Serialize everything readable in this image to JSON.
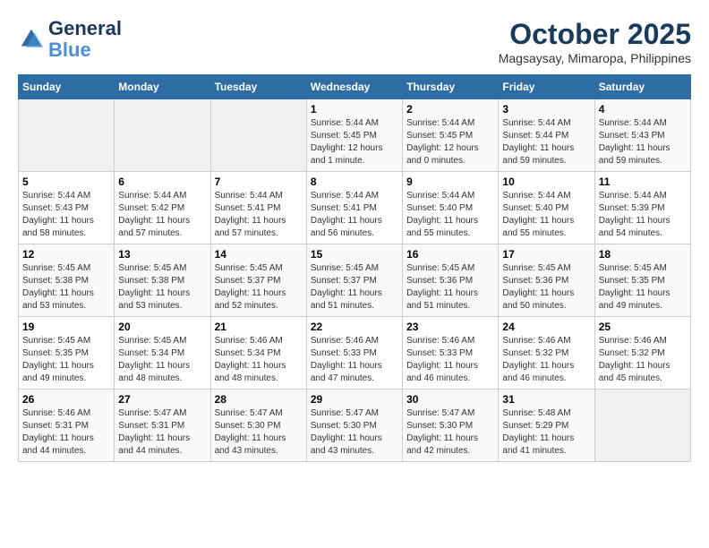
{
  "header": {
    "logo_line1": "General",
    "logo_line2": "Blue",
    "month": "October 2025",
    "location": "Magsaysay, Mimaropa, Philippines"
  },
  "days_of_week": [
    "Sunday",
    "Monday",
    "Tuesday",
    "Wednesday",
    "Thursday",
    "Friday",
    "Saturday"
  ],
  "weeks": [
    [
      {
        "day": "",
        "info": ""
      },
      {
        "day": "",
        "info": ""
      },
      {
        "day": "",
        "info": ""
      },
      {
        "day": "1",
        "info": "Sunrise: 5:44 AM\nSunset: 5:45 PM\nDaylight: 12 hours\nand 1 minute."
      },
      {
        "day": "2",
        "info": "Sunrise: 5:44 AM\nSunset: 5:45 PM\nDaylight: 12 hours\nand 0 minutes."
      },
      {
        "day": "3",
        "info": "Sunrise: 5:44 AM\nSunset: 5:44 PM\nDaylight: 11 hours\nand 59 minutes."
      },
      {
        "day": "4",
        "info": "Sunrise: 5:44 AM\nSunset: 5:43 PM\nDaylight: 11 hours\nand 59 minutes."
      }
    ],
    [
      {
        "day": "5",
        "info": "Sunrise: 5:44 AM\nSunset: 5:43 PM\nDaylight: 11 hours\nand 58 minutes."
      },
      {
        "day": "6",
        "info": "Sunrise: 5:44 AM\nSunset: 5:42 PM\nDaylight: 11 hours\nand 57 minutes."
      },
      {
        "day": "7",
        "info": "Sunrise: 5:44 AM\nSunset: 5:41 PM\nDaylight: 11 hours\nand 57 minutes."
      },
      {
        "day": "8",
        "info": "Sunrise: 5:44 AM\nSunset: 5:41 PM\nDaylight: 11 hours\nand 56 minutes."
      },
      {
        "day": "9",
        "info": "Sunrise: 5:44 AM\nSunset: 5:40 PM\nDaylight: 11 hours\nand 55 minutes."
      },
      {
        "day": "10",
        "info": "Sunrise: 5:44 AM\nSunset: 5:40 PM\nDaylight: 11 hours\nand 55 minutes."
      },
      {
        "day": "11",
        "info": "Sunrise: 5:44 AM\nSunset: 5:39 PM\nDaylight: 11 hours\nand 54 minutes."
      }
    ],
    [
      {
        "day": "12",
        "info": "Sunrise: 5:45 AM\nSunset: 5:38 PM\nDaylight: 11 hours\nand 53 minutes."
      },
      {
        "day": "13",
        "info": "Sunrise: 5:45 AM\nSunset: 5:38 PM\nDaylight: 11 hours\nand 53 minutes."
      },
      {
        "day": "14",
        "info": "Sunrise: 5:45 AM\nSunset: 5:37 PM\nDaylight: 11 hours\nand 52 minutes."
      },
      {
        "day": "15",
        "info": "Sunrise: 5:45 AM\nSunset: 5:37 PM\nDaylight: 11 hours\nand 51 minutes."
      },
      {
        "day": "16",
        "info": "Sunrise: 5:45 AM\nSunset: 5:36 PM\nDaylight: 11 hours\nand 51 minutes."
      },
      {
        "day": "17",
        "info": "Sunrise: 5:45 AM\nSunset: 5:36 PM\nDaylight: 11 hours\nand 50 minutes."
      },
      {
        "day": "18",
        "info": "Sunrise: 5:45 AM\nSunset: 5:35 PM\nDaylight: 11 hours\nand 49 minutes."
      }
    ],
    [
      {
        "day": "19",
        "info": "Sunrise: 5:45 AM\nSunset: 5:35 PM\nDaylight: 11 hours\nand 49 minutes."
      },
      {
        "day": "20",
        "info": "Sunrise: 5:45 AM\nSunset: 5:34 PM\nDaylight: 11 hours\nand 48 minutes."
      },
      {
        "day": "21",
        "info": "Sunrise: 5:46 AM\nSunset: 5:34 PM\nDaylight: 11 hours\nand 48 minutes."
      },
      {
        "day": "22",
        "info": "Sunrise: 5:46 AM\nSunset: 5:33 PM\nDaylight: 11 hours\nand 47 minutes."
      },
      {
        "day": "23",
        "info": "Sunrise: 5:46 AM\nSunset: 5:33 PM\nDaylight: 11 hours\nand 46 minutes."
      },
      {
        "day": "24",
        "info": "Sunrise: 5:46 AM\nSunset: 5:32 PM\nDaylight: 11 hours\nand 46 minutes."
      },
      {
        "day": "25",
        "info": "Sunrise: 5:46 AM\nSunset: 5:32 PM\nDaylight: 11 hours\nand 45 minutes."
      }
    ],
    [
      {
        "day": "26",
        "info": "Sunrise: 5:46 AM\nSunset: 5:31 PM\nDaylight: 11 hours\nand 44 minutes."
      },
      {
        "day": "27",
        "info": "Sunrise: 5:47 AM\nSunset: 5:31 PM\nDaylight: 11 hours\nand 44 minutes."
      },
      {
        "day": "28",
        "info": "Sunrise: 5:47 AM\nSunset: 5:30 PM\nDaylight: 11 hours\nand 43 minutes."
      },
      {
        "day": "29",
        "info": "Sunrise: 5:47 AM\nSunset: 5:30 PM\nDaylight: 11 hours\nand 43 minutes."
      },
      {
        "day": "30",
        "info": "Sunrise: 5:47 AM\nSunset: 5:30 PM\nDaylight: 11 hours\nand 42 minutes."
      },
      {
        "day": "31",
        "info": "Sunrise: 5:48 AM\nSunset: 5:29 PM\nDaylight: 11 hours\nand 41 minutes."
      },
      {
        "day": "",
        "info": ""
      }
    ]
  ]
}
